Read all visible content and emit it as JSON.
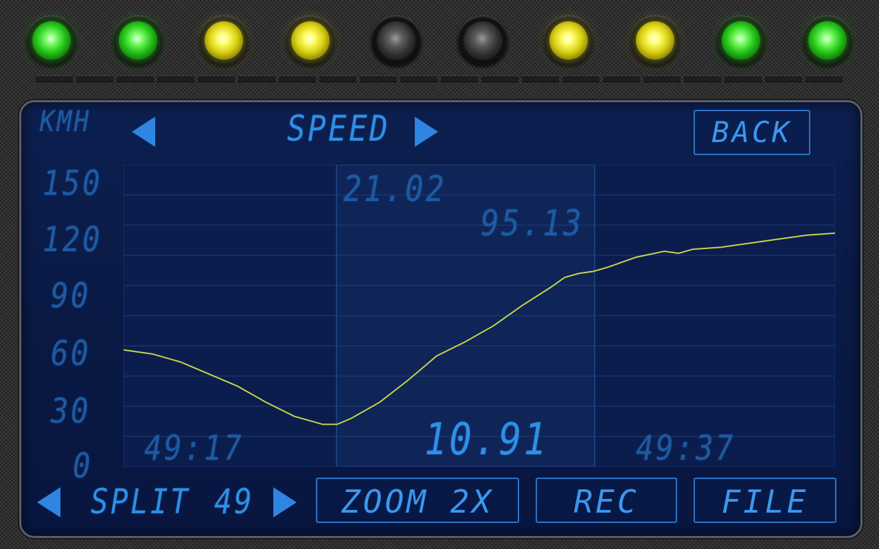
{
  "lights": [
    {
      "state": "green"
    },
    {
      "state": "green"
    },
    {
      "state": "yellow"
    },
    {
      "state": "yellow"
    },
    {
      "state": "off"
    },
    {
      "state": "off"
    },
    {
      "state": "yellow"
    },
    {
      "state": "yellow"
    },
    {
      "state": "green"
    },
    {
      "state": "green"
    }
  ],
  "header": {
    "unit": "KMH",
    "mode_label": "SPEED",
    "back_label": "BACK"
  },
  "axis": {
    "y_ticks": [
      "150",
      "120",
      "90",
      "60",
      "30",
      "0"
    ]
  },
  "readouts": {
    "cursor_time": "21.02",
    "cursor_value": "95.13",
    "start_time": "49:17",
    "elapsed": "10.91",
    "end_time": "49:37"
  },
  "footer": {
    "split_label": "SPLIT",
    "split_value": "49",
    "zoom_label": "ZOOM 2X",
    "rec_label": "REC",
    "file_label": "FILE"
  },
  "colors": {
    "trace": "#c9d44a",
    "segment_blue": "#2f8fe6",
    "grid": "#1d3f7a"
  },
  "chart_data": {
    "type": "line",
    "ylim": [
      0,
      150
    ],
    "xlabel": "",
    "ylabel": "KMH",
    "series": [
      {
        "x": [
          0,
          0.04,
          0.08,
          0.12,
          0.16,
          0.2,
          0.24,
          0.28,
          0.3,
          0.32,
          0.36,
          0.4,
          0.44,
          0.48,
          0.52,
          0.56,
          0.6,
          0.62,
          0.64,
          0.66,
          0.68,
          0.72,
          0.76,
          0.78,
          0.8,
          0.84,
          0.88,
          0.92,
          0.96,
          1.0
        ],
        "y": [
          58,
          56,
          52,
          46,
          40,
          32,
          25,
          21,
          21,
          24,
          32,
          43,
          55,
          62,
          70,
          80,
          89,
          94,
          96,
          97,
          99,
          104,
          107,
          106,
          108,
          109,
          111,
          113,
          115,
          116
        ]
      }
    ]
  }
}
